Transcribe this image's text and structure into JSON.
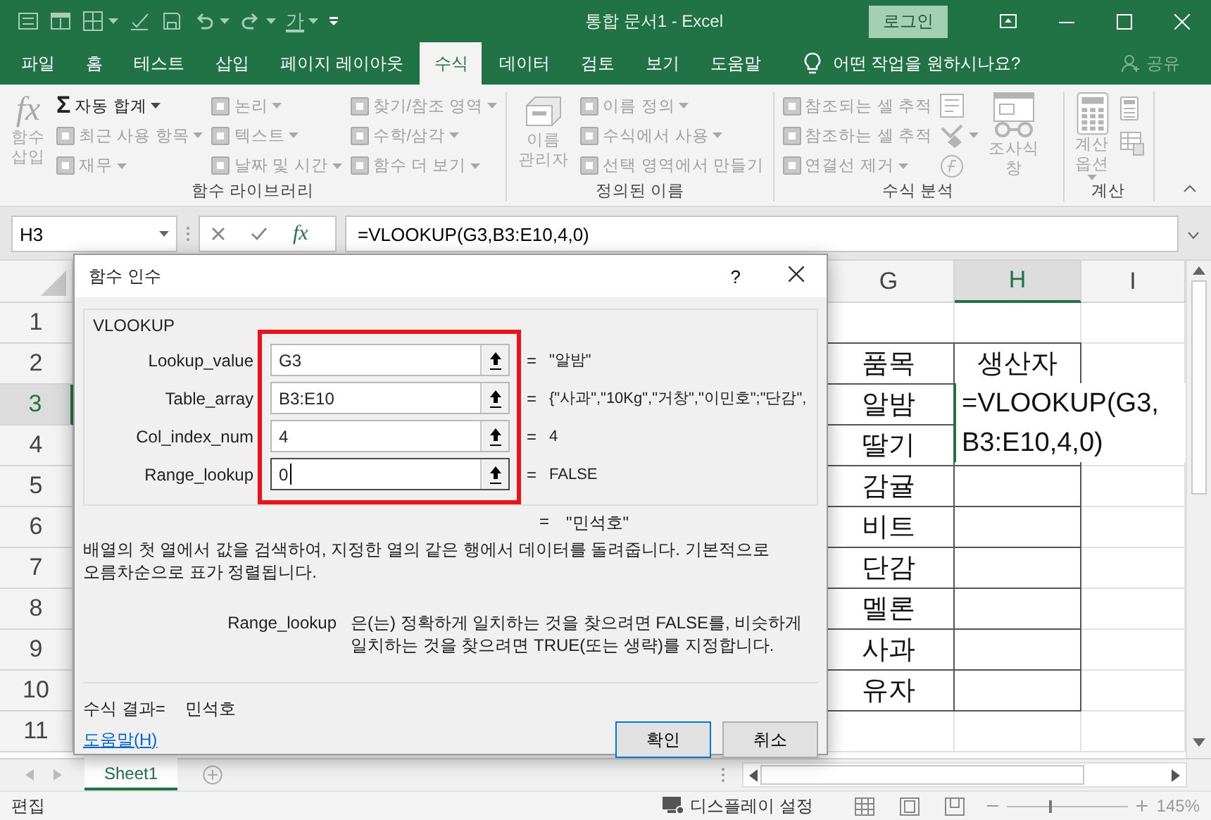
{
  "window": {
    "title": "통합 문서1 - Excel",
    "sign_in": "로그인"
  },
  "quick_access": {
    "font_color_glyph": "가"
  },
  "tabs": [
    {
      "label": "파일",
      "selected": false
    },
    {
      "label": "홈",
      "selected": false
    },
    {
      "label": "테스트",
      "selected": false
    },
    {
      "label": "삽입",
      "selected": false
    },
    {
      "label": "페이지 레이아웃",
      "selected": false
    },
    {
      "label": "수식",
      "selected": true
    },
    {
      "label": "데이터",
      "selected": false
    },
    {
      "label": "검토",
      "selected": false
    },
    {
      "label": "보기",
      "selected": false
    },
    {
      "label": "도움말",
      "selected": false
    }
  ],
  "tell_me": "어떤 작업을 원하시나요?",
  "share": "공유",
  "ribbon": {
    "groups": [
      {
        "label": "함수 라이브러리",
        "items": [
          {
            "kind": "large",
            "icon_text": "fx",
            "lines": [
              "함수",
              "삽입"
            ],
            "dropdown": false,
            "disabled": true
          },
          {
            "kind": "column",
            "items": [
              {
                "glyph": "Σ",
                "label": "자동 합계",
                "dropdown": true,
                "disabled": false
              },
              {
                "label": "최근 사용 항목",
                "dropdown": true,
                "disabled": true
              },
              {
                "label": "재무",
                "dropdown": true,
                "disabled": true
              }
            ]
          },
          {
            "kind": "column",
            "items": [
              {
                "label": "논리",
                "dropdown": true,
                "disabled": true
              },
              {
                "label": "텍스트",
                "dropdown": true,
                "disabled": true
              },
              {
                "label": "날짜 및 시간",
                "dropdown": true,
                "disabled": true
              }
            ]
          },
          {
            "kind": "column",
            "items": [
              {
                "label": "찾기/참조 영역",
                "dropdown": true,
                "disabled": true
              },
              {
                "label": "수학/삼각",
                "dropdown": true,
                "disabled": true
              },
              {
                "label": "함수 더 보기",
                "dropdown": true,
                "disabled": true
              }
            ]
          }
        ]
      },
      {
        "label": "정의된 이름",
        "items": [
          {
            "kind": "large",
            "lines": [
              "이름",
              "관리자"
            ],
            "dropdown": false,
            "disabled": true
          },
          {
            "kind": "column",
            "items": [
              {
                "label": "이름 정의",
                "dropdown": true,
                "disabled": true
              },
              {
                "label": "수식에서 사용",
                "dropdown": true,
                "disabled": true
              },
              {
                "label": "선택 영역에서 만들기",
                "dropdown": false,
                "disabled": true
              }
            ]
          }
        ]
      },
      {
        "label": "수식 분석",
        "items": [
          {
            "kind": "column",
            "items": [
              {
                "label": "참조되는 셀 추적",
                "dropdown": false,
                "disabled": true
              },
              {
                "label": "참조하는 셀 추적",
                "dropdown": false,
                "disabled": true
              },
              {
                "label": "연결선 제거",
                "dropdown": true,
                "disabled": true
              }
            ]
          },
          {
            "kind": "column",
            "items": [
              {
                "dropdown": false,
                "disabled": true
              },
              {
                "dropdown": true,
                "disabled": true
              },
              {
                "dropdown": false,
                "disabled": true
              }
            ]
          },
          {
            "kind": "large",
            "lines": [
              "조사식",
              "창"
            ],
            "dropdown": false,
            "disabled": true
          }
        ]
      },
      {
        "label": "계산",
        "items": [
          {
            "kind": "large",
            "lines": [
              "계산",
              "옵션"
            ],
            "dropdown": true,
            "disabled": true
          },
          {
            "kind": "column",
            "items": [
              {
                "dropdown": false,
                "disabled": true
              },
              {
                "dropdown": false,
                "disabled": true
              }
            ]
          }
        ]
      }
    ]
  },
  "formula_bar": {
    "name_box": "H3",
    "function_glyph": "fx",
    "formula": "=VLOOKUP(G3,B3:E10,4,0)"
  },
  "sheet": {
    "columns": [
      {
        "label": "G",
        "selected": false
      },
      {
        "label": "H",
        "selected": true
      },
      {
        "label": "I",
        "selected": false
      }
    ],
    "rows": [
      {
        "header": "1",
        "selected": false,
        "editing": false
      },
      {
        "header": "2",
        "selected": false,
        "editing": false,
        "item": "품목",
        "producer": "생산자"
      },
      {
        "header": "3",
        "selected": true,
        "editing": true,
        "item": "알밤",
        "producer": "=VLOOKUP(G3,B3:E10,4,0)"
      },
      {
        "header": "4",
        "selected": false,
        "editing": false,
        "item": "딸기"
      },
      {
        "header": "5",
        "selected": false,
        "editing": false,
        "item": "감귤"
      },
      {
        "header": "6",
        "selected": false,
        "editing": false,
        "item": "비트"
      },
      {
        "header": "7",
        "selected": false,
        "editing": false,
        "item": "단감"
      },
      {
        "header": "8",
        "selected": false,
        "editing": false,
        "item": "멜론"
      },
      {
        "header": "9",
        "selected": false,
        "editing": false,
        "item": "사과"
      },
      {
        "header": "10",
        "selected": false,
        "editing": false,
        "item": "유자"
      },
      {
        "header": "11",
        "selected": false,
        "editing": false
      }
    ]
  },
  "sheet_tabs": [
    {
      "label": "Sheet1",
      "selected": true
    }
  ],
  "status_bar": {
    "mode": "편집",
    "display_settings": "디스플레이 설정",
    "zoom": {
      "level": 0.34,
      "reading": "145%"
    }
  },
  "dialog": {
    "title": "함수 인수",
    "help_glyph": "?",
    "function_name": "VLOOKUP",
    "highlight_arguments": true,
    "arguments": [
      {
        "name": "Lookup_value",
        "value": "G3",
        "equals": "=",
        "result": "\"알밤\"",
        "focused": false
      },
      {
        "name": "Table_array",
        "value": "B3:E10",
        "equals": "=",
        "result": "{\"사과\",\"10Kg\",\"거창\",\"이민호\";\"단감\",",
        "focused": false
      },
      {
        "name": "Col_index_num",
        "value": "4",
        "equals": "=",
        "result": "4",
        "focused": false
      },
      {
        "name": "Range_lookup",
        "value": "0",
        "equals": "=",
        "result": "FALSE",
        "focused": true
      }
    ],
    "result_line": {
      "equals": "=",
      "value": "\"민석호\""
    },
    "description": "배열의 첫 열에서 값을 검색하여, 지정한 열의 같은 행에서 데이터를 돌려줍니다. 기본적으로 오름차순으로 표가 정렬됩니다.",
    "argument_help": {
      "name": "Range_lookup",
      "text": "은(는) 정확하게 일치하는 것을 찾으려면 FALSE를, 비슷하게 일치하는 것을 찾으려면 TRUE(또는 생략)를 지정합니다."
    },
    "formula_result": {
      "label": "수식 결과=",
      "value": "민석호"
    },
    "help_link": "도움말(H)",
    "buttons": [
      {
        "label": "확인",
        "default": true
      },
      {
        "label": "취소",
        "default": false
      }
    ]
  }
}
